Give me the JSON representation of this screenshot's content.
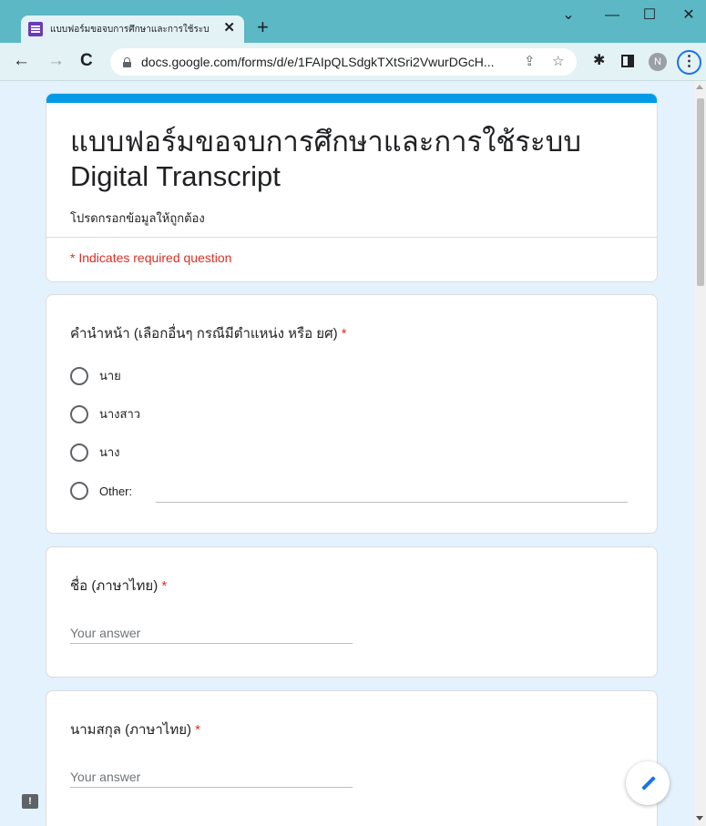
{
  "browser": {
    "tab_title": "แบบฟอร์มขอจบการศึกษาและการใช้ระบ",
    "tab_close": "✕",
    "new_tab": "+",
    "url": "docs.google.com/forms/d/e/1FAIpQLSdgkTXtSri2VwurDGcH...",
    "avatar_initial": "N",
    "window_controls": {
      "minimize": "—",
      "maximize": "☐",
      "close": "✕",
      "dropdown": "⌄"
    }
  },
  "form": {
    "title": "แบบฟอร์มขอจบการศึกษาและการใช้ระบบ Digital Transcript",
    "description": "โปรดกรอกข้อมูลให้ถูกต้อง",
    "required_note": "* Indicates required question",
    "q1": {
      "label": "คำนำหน้า (เลือกอื่นๆ กรณีมีตำแหน่ง หรือ ยศ)",
      "required_mark": "*",
      "options": [
        "นาย",
        "นางสาว",
        "นาง",
        "Other:"
      ]
    },
    "q2": {
      "label": "ชื่อ (ภาษาไทย)",
      "required_mark": "*",
      "placeholder": "Your answer"
    },
    "q3": {
      "label": "นามสกุล (ภาษาไทย)",
      "required_mark": "*",
      "placeholder": "Your answer"
    }
  },
  "icons": {
    "favicon": "google-forms-icon",
    "lock": "lock-icon",
    "share": "share-icon",
    "bookmark": "star-icon",
    "extensions": "puzzle-icon",
    "edit": "pencil-icon",
    "report": "report-icon"
  },
  "colors": {
    "accent": "#039be5",
    "page_background": "#e3f2fd",
    "titlebar": "#5bb8c4",
    "required": "#d93025"
  }
}
